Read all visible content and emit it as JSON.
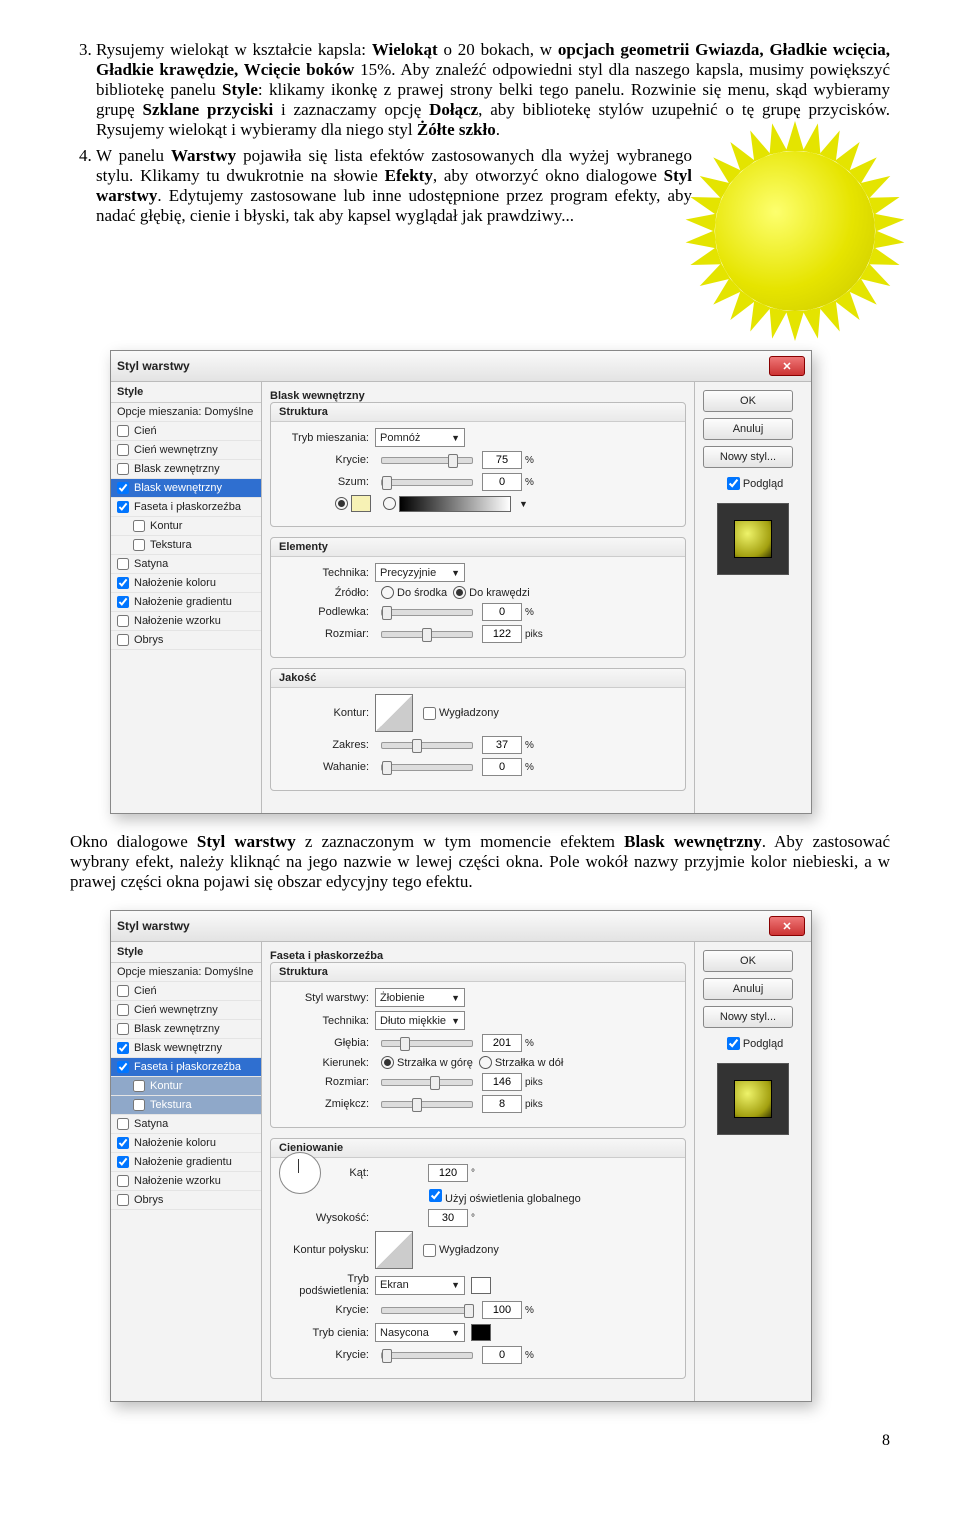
{
  "list3_pre": "Rysujemy wielokąt w kształcie kapsla: ",
  "list3_b1": "Wielokąt",
  "list3_mid1": " o 20 bokach, w ",
  "list3_b2": "opcjach geometrii Gwiazda, Gładkie wcięcia, Gładkie krawędzie, Wcięcie boków",
  "list3_mid2": " 15%. Aby znaleźć odpowiedni styl dla naszego kapsla, musimy powiększyć bibliotekę panelu ",
  "list3_b3": "Style",
  "list3_mid3": ": klikamy ikonkę z prawej strony belki tego panelu. Rozwinie się menu, skąd wybieramy grupę ",
  "list3_b4": "Szklane przyciski",
  "list3_mid4": " i zaznaczamy opcję ",
  "list3_b5": "Dołącz",
  "list3_mid5": ", aby bibliotekę stylów uzupełnić o tę grupę przycisków. Rysujemy wielokąt i wybieramy dla niego styl ",
  "list3_b6": "Żółte szkło",
  "list3_end": ".",
  "list4_pre": "W panelu ",
  "list4_b1": "Warstwy",
  "list4_mid1": " pojawiła się lista efektów zastosowanych dla wyżej wybranego stylu. Klikamy tu dwukrotnie na słowie ",
  "list4_b2": "Efekty",
  "list4_mid2": ", aby otworzyć okno dialogowe ",
  "list4_b3": "Styl warstwy",
  "list4_mid3": ". Edytujemy zastosowane lub inne udostępnione przez program efekty, aby nadać głębię, cienie i błyski, tak aby kapsel wyglądał jak prawdziwy...",
  "para2_pre": "Okno dialogowe ",
  "para2_b1": "Styl warstwy",
  "para2_mid1": " z zaznaczonym w tym momencie efektem ",
  "para2_b2": "Blask wewnętrzny",
  "para2_mid2": ". Aby zastosować wybrany efekt, należy kliknąć na jego nazwie w lewej części okna. Pole wokół nazwy przyjmie kolor niebieski, a w prawej części okna pojawi się obszar edycyjny tego efektu.",
  "dlgTitle": "Styl warstwy",
  "styleHdr": "Style",
  "opcje": "Opcje mieszania: Domyślne",
  "s_cien": "Cień",
  "s_cienw": "Cień wewnętrzny",
  "s_blaskz": "Blask zewnętrzny",
  "s_blaskw": "Blask wewnętrzny",
  "s_faseta": "Faseta i płaskorzeźba",
  "s_kontur": "Kontur",
  "s_tekstura": "Tekstura",
  "s_satyna": "Satyna",
  "s_nalk": "Nałożenie koloru",
  "s_nalg": "Nałożenie gradientu",
  "s_nalw": "Nałożenie wzorku",
  "s_obrys": "Obrys",
  "ok": "OK",
  "anuluj": "Anuluj",
  "nowystyl": "Nowy styl...",
  "podglad": "Podgląd",
  "d1": {
    "title": "Blask wewnętrzny",
    "g1": "Struktura",
    "tryb": "Tryb mieszania:",
    "trybVal": "Pomnóż",
    "krycie": "Krycie:",
    "krycieVal": "75",
    "szum": "Szum:",
    "szumVal": "0",
    "pct": "%",
    "g2": "Elementy",
    "technika": "Technika:",
    "technikaVal": "Precyzyjnie",
    "zrodlo": "Źródło:",
    "zr1": "Do środka",
    "zr2": "Do krawędzi",
    "podlewka": "Podlewka:",
    "podlewkaVal": "0",
    "rozmiar": "Rozmiar:",
    "rozmiarVal": "122",
    "piks": "piks",
    "g3": "Jakość",
    "kontur": "Kontur:",
    "wygl": "Wygładzony",
    "zakres": "Zakres:",
    "zakresVal": "37",
    "wahanie": "Wahanie:",
    "wahanieVal": "0"
  },
  "d2": {
    "title": "Faseta i płaskorzeźba",
    "g1": "Struktura",
    "styl": "Styl warstwy:",
    "stylVal": "Żłobienie",
    "technika": "Technika:",
    "technikaVal": "Dłuto miękkie",
    "glebia": "Głębia:",
    "glebiaVal": "201",
    "kierunek": "Kierunek:",
    "k1": "Strzałka w górę",
    "k2": "Strzałka w dół",
    "rozmiar": "Rozmiar:",
    "rozmiarVal": "146",
    "zmiekcz": "Zmiękcz:",
    "zmiekczVal": "8",
    "g2": "Cieniowanie",
    "kat": "Kąt:",
    "katVal": "120",
    "deg": "°",
    "uzyj": "Użyj oświetlenia globalnego",
    "wys": "Wysokość:",
    "wysVal": "30",
    "kpolysk": "Kontur połysku:",
    "wygl": "Wygładzony",
    "trybp": "Tryb podświetlenia:",
    "trybpVal": "Ekran",
    "krycie": "Krycie:",
    "krycieVal": "100",
    "trybc": "Tryb cienia:",
    "trybcVal": "Nasycona",
    "krycie2Val": "0",
    "pct": "%",
    "piks": "piks"
  },
  "pageNo": "8"
}
